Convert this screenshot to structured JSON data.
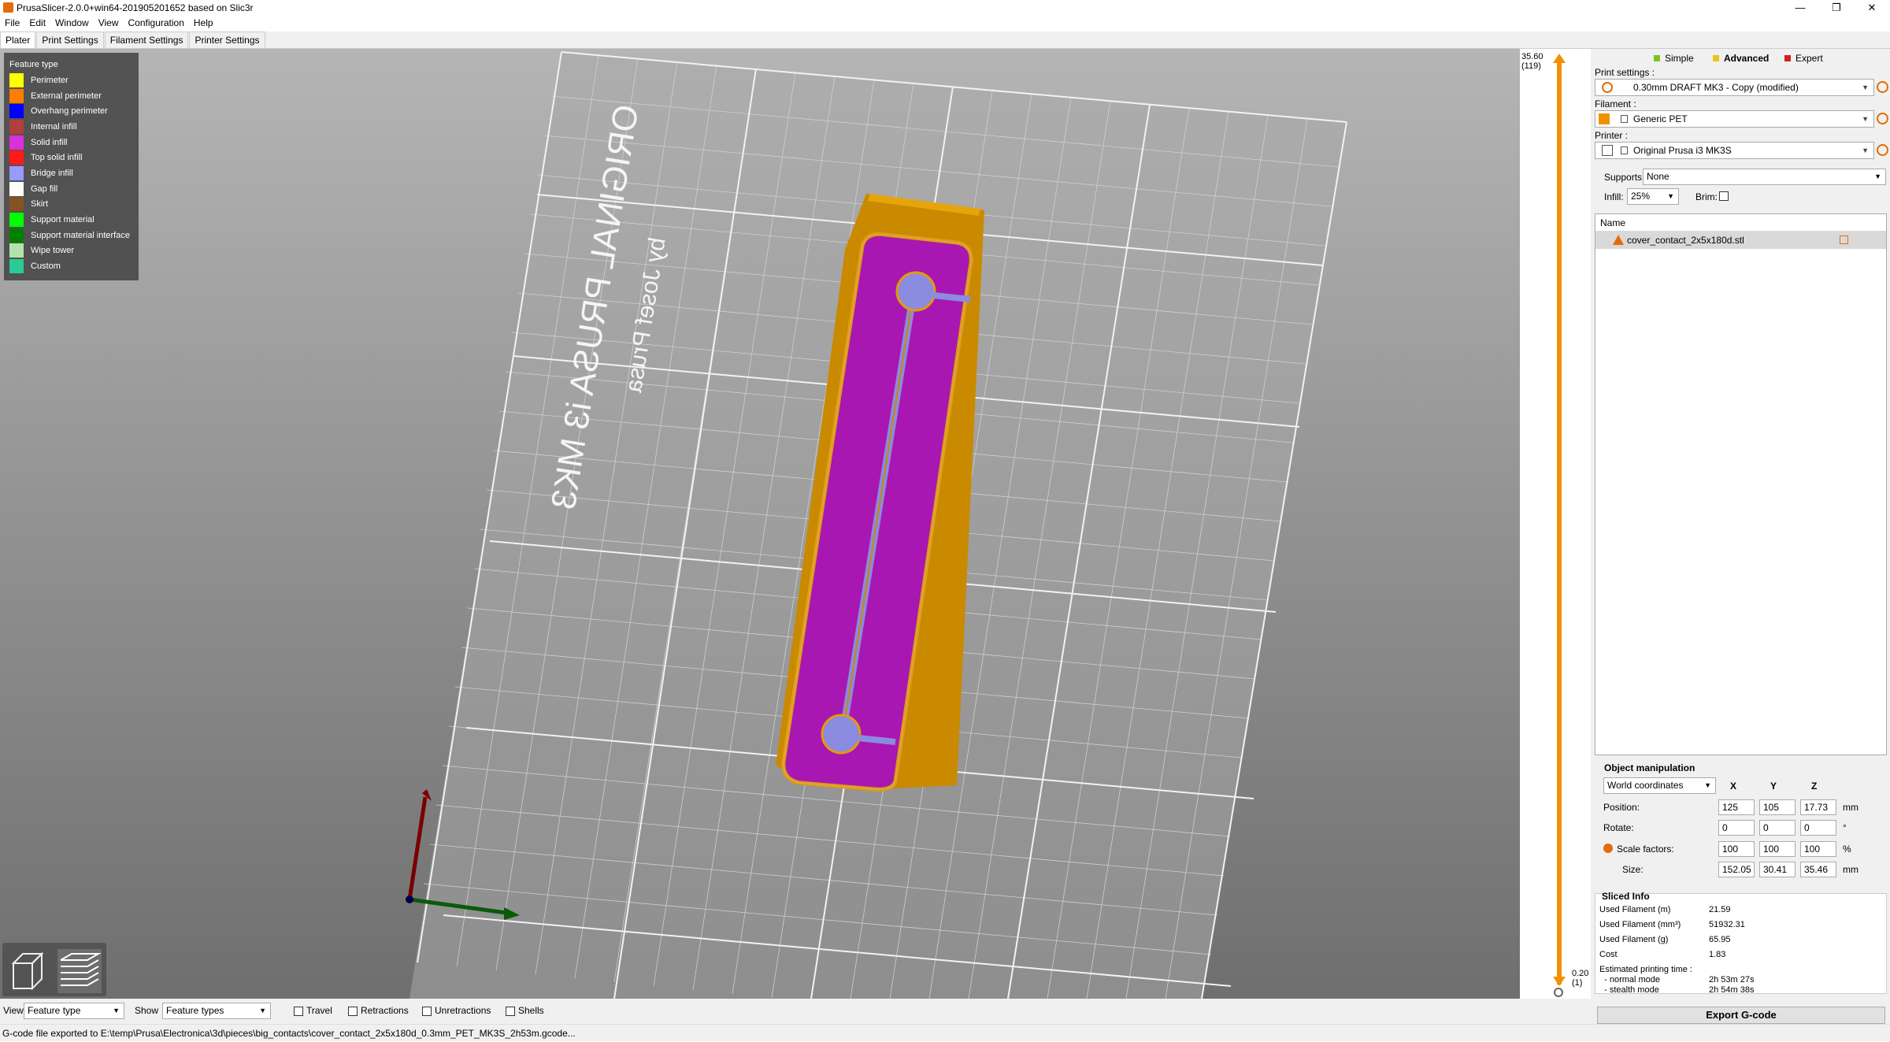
{
  "window": {
    "title": "PrusaSlicer-2.0.0+win64-201905201652 based on Slic3r",
    "min_glyph": "—",
    "max_glyph": "❐",
    "close_glyph": "✕"
  },
  "menu": [
    "File",
    "Edit",
    "Window",
    "View",
    "Configuration",
    "Help"
  ],
  "tabs": [
    "Plater",
    "Print Settings",
    "Filament Settings",
    "Printer Settings"
  ],
  "legend": {
    "title": "Feature type",
    "items": [
      {
        "label": "Perimeter",
        "color": "#ffff00"
      },
      {
        "label": "External perimeter",
        "color": "#ff7d00"
      },
      {
        "label": "Overhang perimeter",
        "color": "#0000ff"
      },
      {
        "label": "Internal infill",
        "color": "#b13f3f"
      },
      {
        "label": "Solid infill",
        "color": "#d732d7"
      },
      {
        "label": "Top solid infill",
        "color": "#ff1a1a"
      },
      {
        "label": "Bridge infill",
        "color": "#9999ff"
      },
      {
        "label": "Gap fill",
        "color": "#ffffff"
      },
      {
        "label": "Skirt",
        "color": "#845321"
      },
      {
        "label": "Support material",
        "color": "#00ff00"
      },
      {
        "label": "Support material interface",
        "color": "#008000"
      },
      {
        "label": "Wipe tower",
        "color": "#b3e3ab"
      },
      {
        "label": "Custom",
        "color": "#28cc94"
      }
    ]
  },
  "bed_text": {
    "line1": "ORIGINAL PRUSA i3 MK3",
    "line2": "by Josef Prusa"
  },
  "layer_slider": {
    "top_value": "35.60",
    "top_layer": "(119)",
    "bottom_value": "0.20",
    "bottom_layer": "(1)"
  },
  "modes": [
    {
      "label": "Simple",
      "color": "#7cc520"
    },
    {
      "label": "Advanced",
      "color": "#e8c51b"
    },
    {
      "label": "Expert",
      "color": "#d21f1f"
    }
  ],
  "presets": {
    "print_label": "Print settings :",
    "print_value": "0.30mm DRAFT MK3 - Copy (modified)",
    "filament_label": "Filament :",
    "filament_value": "Generic PET",
    "filament_color": "#f29100",
    "printer_label": "Printer :",
    "printer_value": "Original Prusa i3 MK3S"
  },
  "supports": {
    "label": "Supports:",
    "value": "None"
  },
  "infill": {
    "label": "Infill:",
    "value": "25%"
  },
  "brim": {
    "label": "Brim:"
  },
  "object_list": {
    "header": "Name",
    "objects": [
      {
        "name": "cover_contact_2x5x180d.stl"
      }
    ]
  },
  "object_manipulation": {
    "title": "Object manipulation",
    "coord_system": "World coordinates",
    "axes": [
      "X",
      "Y",
      "Z"
    ],
    "rows": [
      {
        "label": "Position:",
        "values": [
          "125",
          "105",
          "17.73"
        ],
        "unit": "mm"
      },
      {
        "label": "Rotate:",
        "values": [
          "0",
          "0",
          "0"
        ],
        "unit": "°"
      },
      {
        "label": "Scale factors:",
        "values": [
          "100",
          "100",
          "100"
        ],
        "unit": "%"
      },
      {
        "label": "Size:",
        "values": [
          "152.05",
          "30.41",
          "35.46"
        ],
        "unit": "mm"
      }
    ]
  },
  "sliced_info": {
    "title": "Sliced Info",
    "rows": [
      {
        "label": "Used Filament (m)",
        "value": "21.59"
      },
      {
        "label": "Used Filament (mm³)",
        "value": "51932.31"
      },
      {
        "label": "Used Filament (g)",
        "value": "65.95"
      },
      {
        "label": "Cost",
        "value": "1.83"
      },
      {
        "label": "Estimated printing time :",
        "value": ""
      },
      {
        "label": "  - normal mode",
        "value": "2h 53m 27s"
      },
      {
        "label": "  - stealth mode",
        "value": "2h 54m 38s"
      }
    ]
  },
  "export_button": "Export G-code",
  "bottom": {
    "view_label": "View",
    "view_value": "Feature type",
    "show_label": "Show",
    "show_value": "Feature types",
    "checkboxes": [
      "Travel",
      "Retractions",
      "Unretractions",
      "Shells"
    ]
  },
  "status": "G-code file exported to E:\\temp\\Prusa\\Electronica\\3d\\pieces\\big_contacts\\cover_contact_2x5x180d_0.3mm_PET_MK3S_2h53m.gcode..."
}
